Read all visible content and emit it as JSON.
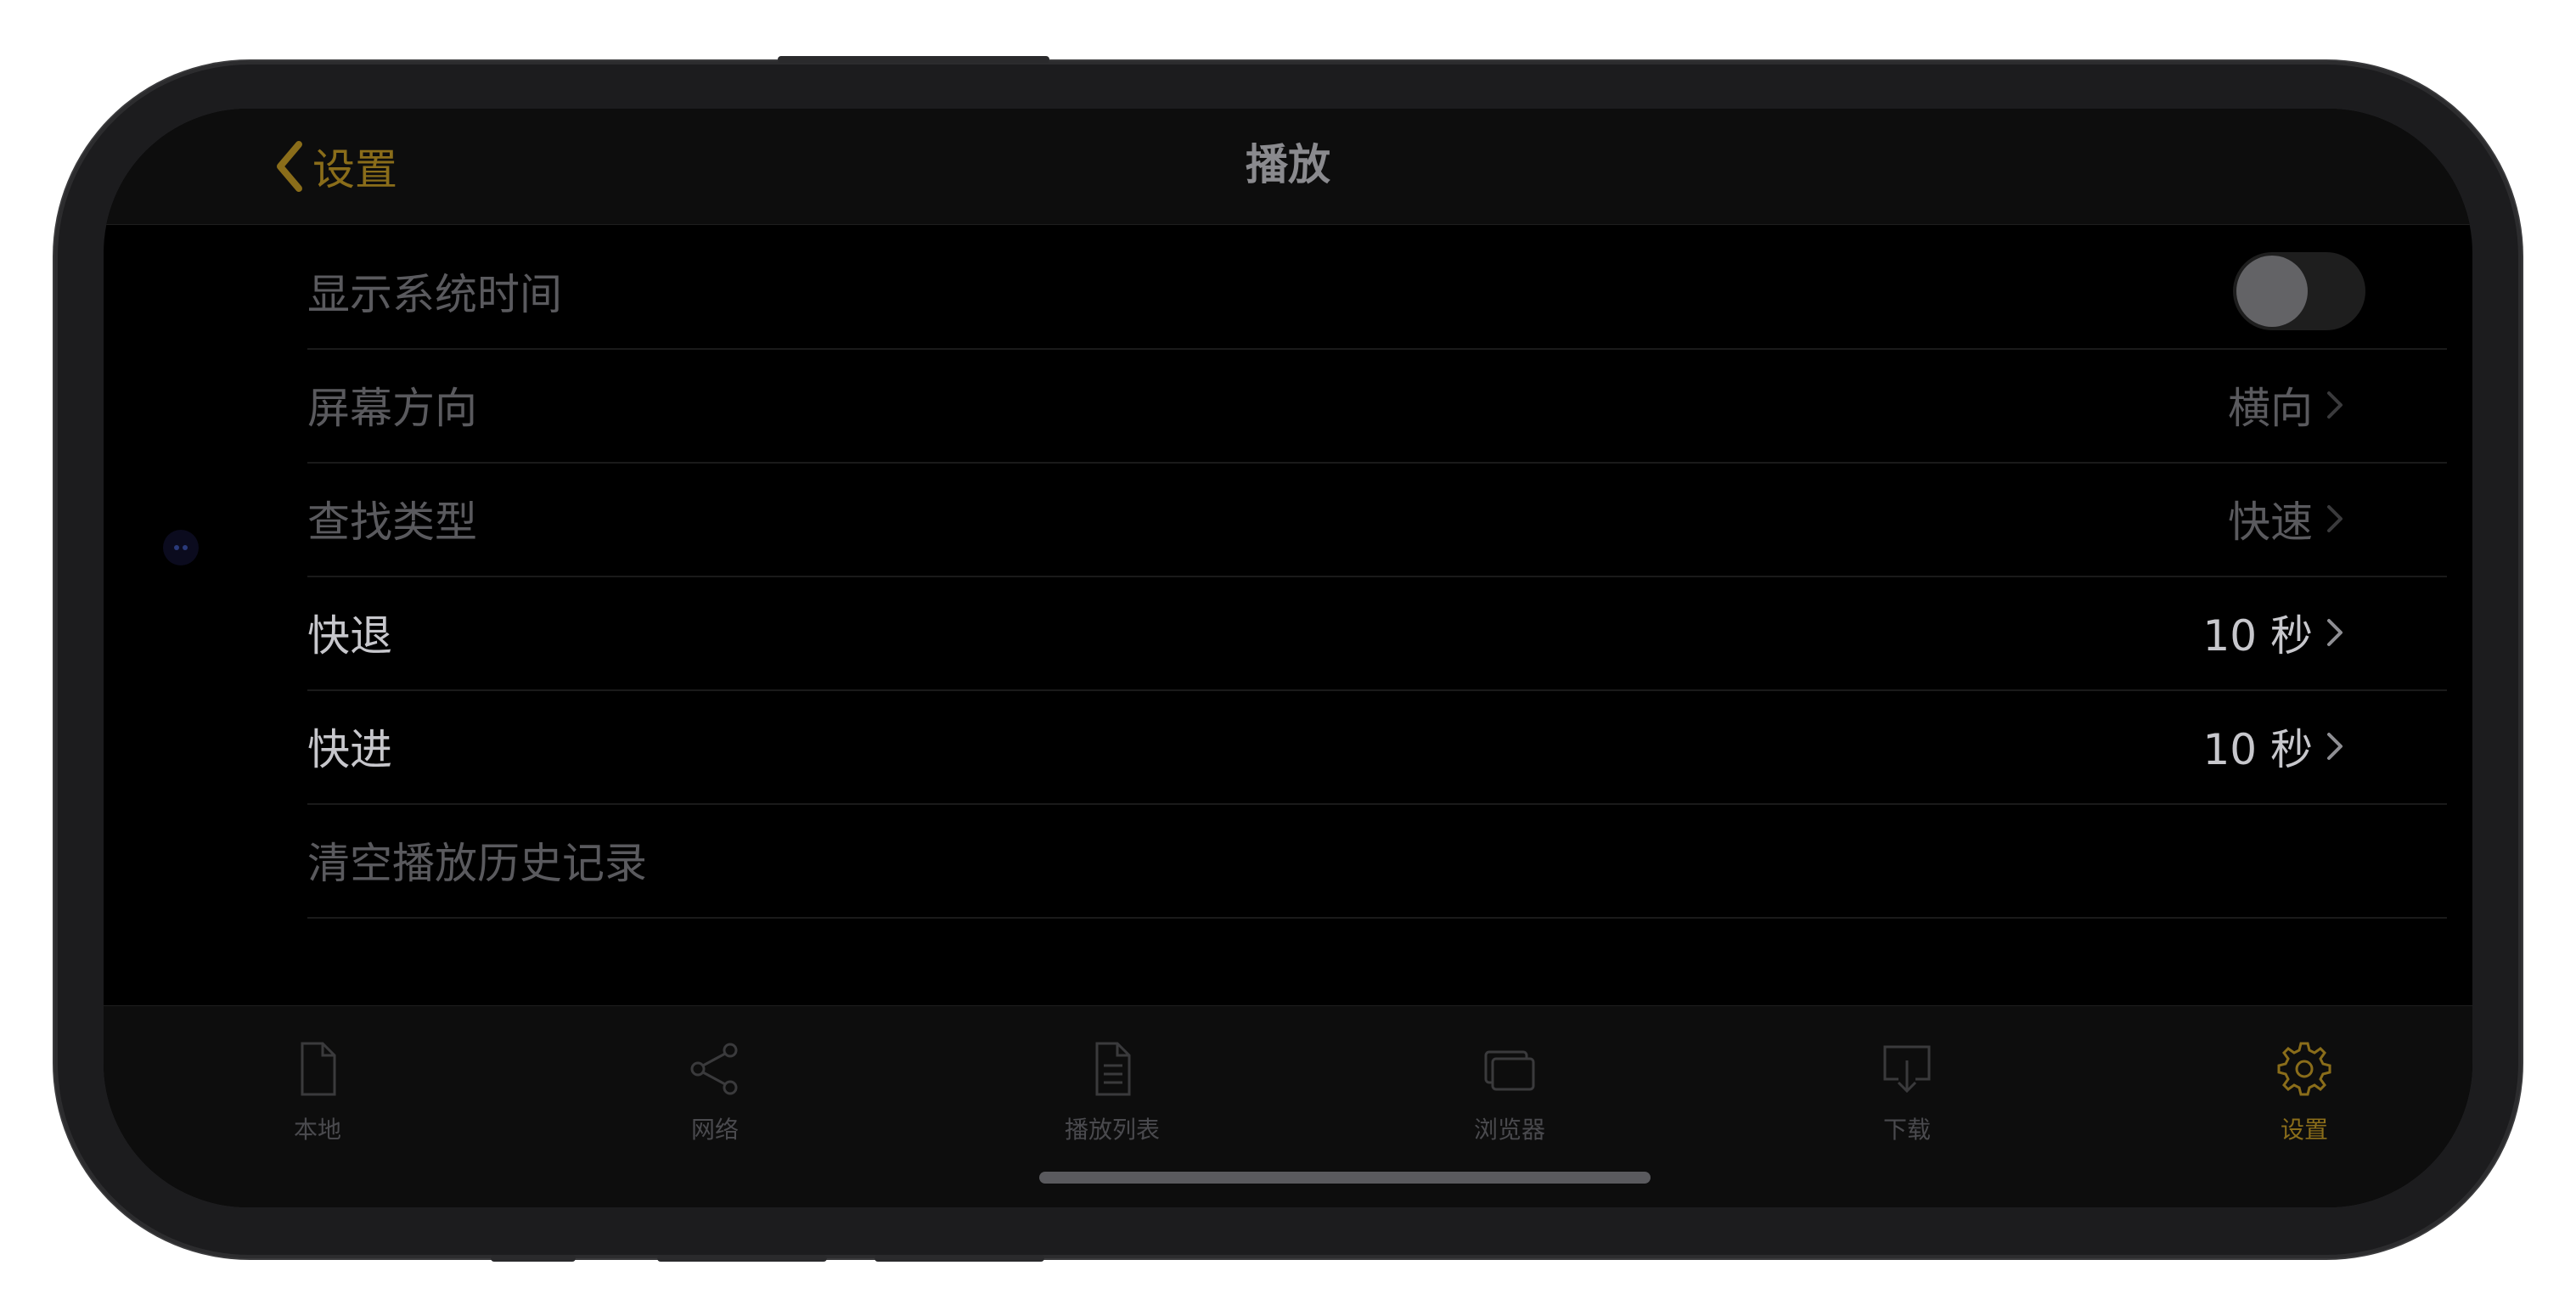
{
  "nav": {
    "back_label": "设置",
    "title": "播放"
  },
  "settings": [
    {
      "label": "显示系统时间",
      "control": "toggle",
      "toggle_on": false
    },
    {
      "label": "屏幕方向",
      "value": "横向"
    },
    {
      "label": "查找类型",
      "value": "快速"
    },
    {
      "label": "快退",
      "value": "10 秒"
    },
    {
      "label": "快进",
      "value": "10 秒"
    },
    {
      "label": "清空播放历史记录"
    }
  ],
  "tabs": [
    {
      "label": "本地",
      "icon": "document-icon"
    },
    {
      "label": "网络",
      "icon": "share-icon"
    },
    {
      "label": "播放列表",
      "icon": "list-document-icon"
    },
    {
      "label": "浏览器",
      "icon": "windows-icon"
    },
    {
      "label": "下载",
      "icon": "download-tray-icon"
    },
    {
      "label": "设置",
      "icon": "gear-icon",
      "active": true
    }
  ],
  "colors": {
    "accent": "#8a6d1a",
    "background": "#000000",
    "bar": "#0d0d0d",
    "dim_text": "#5a5a5e",
    "bright_text": "#c7c7cc"
  }
}
